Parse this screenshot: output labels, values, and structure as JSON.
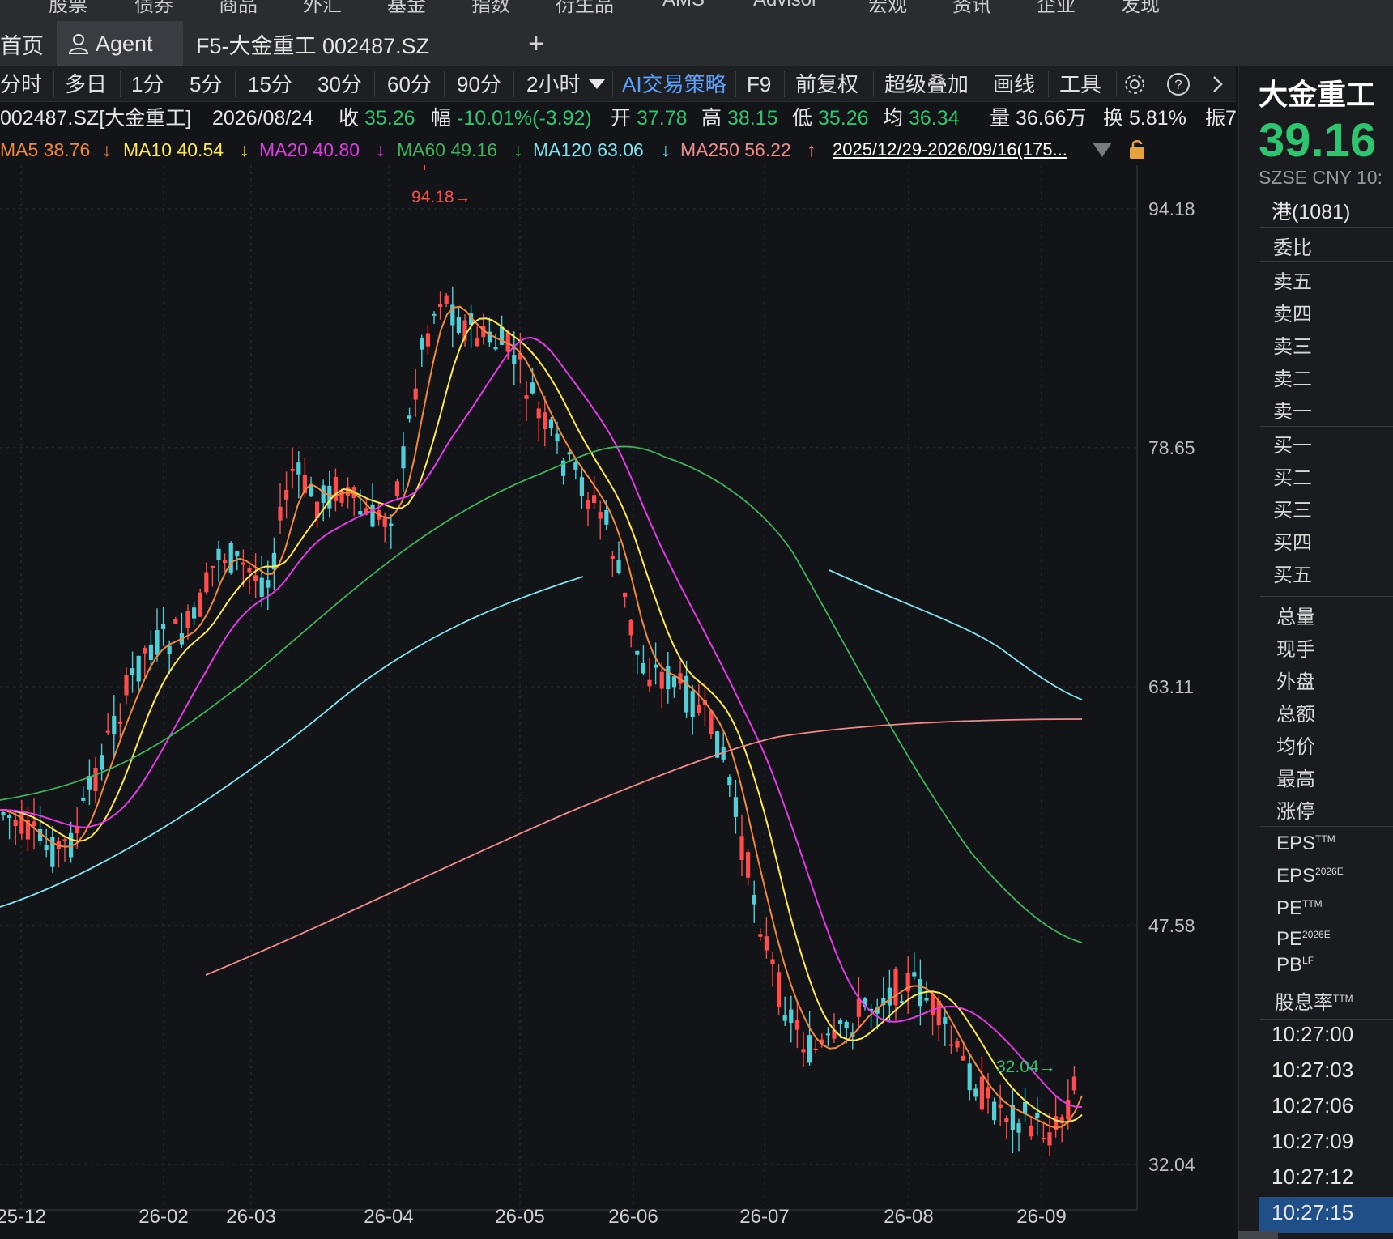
{
  "topnav": [
    "股票",
    "债券",
    "商品",
    "外汇",
    "基金",
    "指数",
    "衍生品",
    "AMS",
    "Advisor",
    "宏观",
    "资讯",
    "企业",
    "发现"
  ],
  "tabs": {
    "home": "首页",
    "agent": "Agent",
    "stock_tab": "F5-大金重工 002487.SZ",
    "add": "+"
  },
  "toolbar": {
    "items": [
      "分时",
      "多日",
      "1分",
      "5分",
      "15分",
      "30分",
      "60分",
      "90分",
      "2小时"
    ],
    "ai_strategy": "AI交易策略",
    "f9": "F9",
    "adjust": "前复权",
    "overlay": "超级叠加",
    "draw": "画线",
    "tools": "工具"
  },
  "info": {
    "code": "002487.SZ[大金重工]",
    "date": "2026/08/24",
    "close_label": "收",
    "close": "35.26",
    "change_label": "幅",
    "change": "-10.01%(-3.92)",
    "open_label": "开",
    "open": "37.78",
    "high_label": "高",
    "high": "38.15",
    "low_label": "低",
    "low": "35.26",
    "avg_label": "均",
    "avg": "36.34",
    "vol_label": "量",
    "vol": "36.66万",
    "turnover_label": "换",
    "turnover": "5.81%",
    "amp_label": "振7"
  },
  "ma": {
    "ma5": "MA5 38.76",
    "ma10": "MA10 40.54",
    "ma20": "MA20 40.80",
    "ma60": "MA60 49.16",
    "ma120": "MA120 63.06",
    "ma250": "MA250 56.22",
    "period": "2025/12/29-2026/09/16(175...",
    "arrow_down": "↓",
    "arrow_up": "↑"
  },
  "colors": {
    "ma5": "#f0883e",
    "ma10": "#ffe84d",
    "ma20": "#e23be6",
    "ma60": "#3fb35a",
    "ma120": "#7fe3f0",
    "ma250": "#f28a8a",
    "up": "#ff4d4d",
    "down": "#4fd0d8",
    "green_text": "#2fc46f"
  },
  "chart_data": {
    "type": "candlestick",
    "y_ticks": [
      "94.18",
      "78.65",
      "63.11",
      "47.58",
      "32.04"
    ],
    "x_ticks": [
      "25-12",
      "26-02",
      "26-03",
      "26-04",
      "26-05",
      "26-06",
      "26-07",
      "26-08",
      "26-09"
    ],
    "max_label": "94.18",
    "min_label": "32.04",
    "ylim": [
      32.04,
      94.18
    ]
  },
  "side": {
    "name": "大金重工",
    "price": "39.16",
    "exch": "SZSE  CNY  10:",
    "hk": "港(1081)",
    "ratio": "委比",
    "sells": [
      "卖五",
      "卖四",
      "卖三",
      "卖二",
      "卖一"
    ],
    "buys": [
      "买一",
      "买二",
      "买三",
      "买四",
      "买五"
    ],
    "stats": [
      "总量",
      "现手",
      "外盘",
      "总额",
      "均价",
      "最高",
      "涨停"
    ],
    "eps_ttm": "EPS",
    "eps_ttm_sup": "TTM",
    "eps_e": "EPS",
    "eps_e_sup": "2026E",
    "pe_ttm": "PE",
    "pe_ttm_sup": "TTM",
    "pe_e": "PE",
    "pe_e_sup": "2026E",
    "pb": "PB",
    "pb_sup": "LF",
    "div": "股息率",
    "div_sup": "TTM",
    "times": [
      "10:27:00",
      "10:27:03",
      "10:27:06",
      "10:27:09",
      "10:27:12",
      "10:27:15"
    ]
  }
}
